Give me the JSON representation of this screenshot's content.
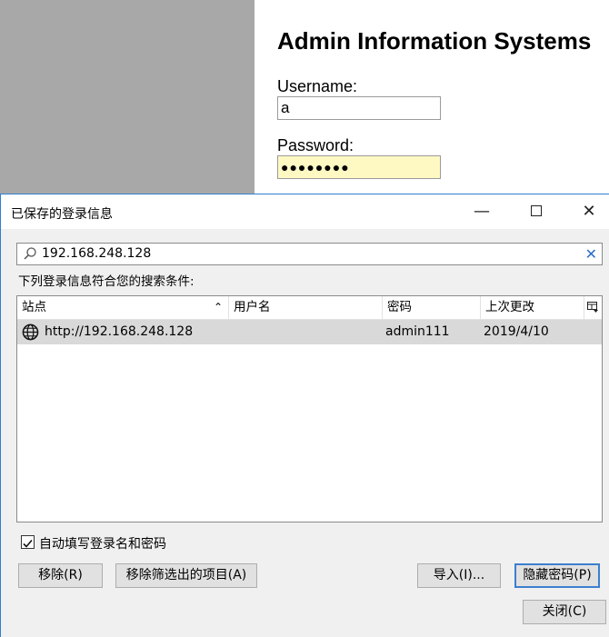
{
  "webpage": {
    "title": "Admin Information Systems",
    "username_label": "Username:",
    "username_value": "a",
    "password_label": "Password:",
    "password_value": "●●●●●●●●"
  },
  "dialog": {
    "title": "已保存的登录信息",
    "search_value": "192.168.248.128",
    "result_label": "下列登录信息符合您的搜索条件:",
    "columns": {
      "site": "站点",
      "username": "用户名",
      "password": "密码",
      "last_changed": "上次更改"
    },
    "rows": [
      {
        "site": "http://192.168.248.128",
        "username": "",
        "password": "admin111",
        "last_changed": "2019/4/10"
      }
    ],
    "autofill_label": "自动填写登录名和密码",
    "autofill_checked": true,
    "buttons": {
      "remove": "移除(R)",
      "remove_filtered": "移除筛选出的项目(A)",
      "import": "导入(I)...",
      "hide_passwords": "隐藏密码(P)",
      "close": "关闭(C)"
    }
  },
  "colors": {
    "accent": "#3c7fd0",
    "password_fill": "#fef9c3",
    "selected_row": "#d9d9d9"
  }
}
